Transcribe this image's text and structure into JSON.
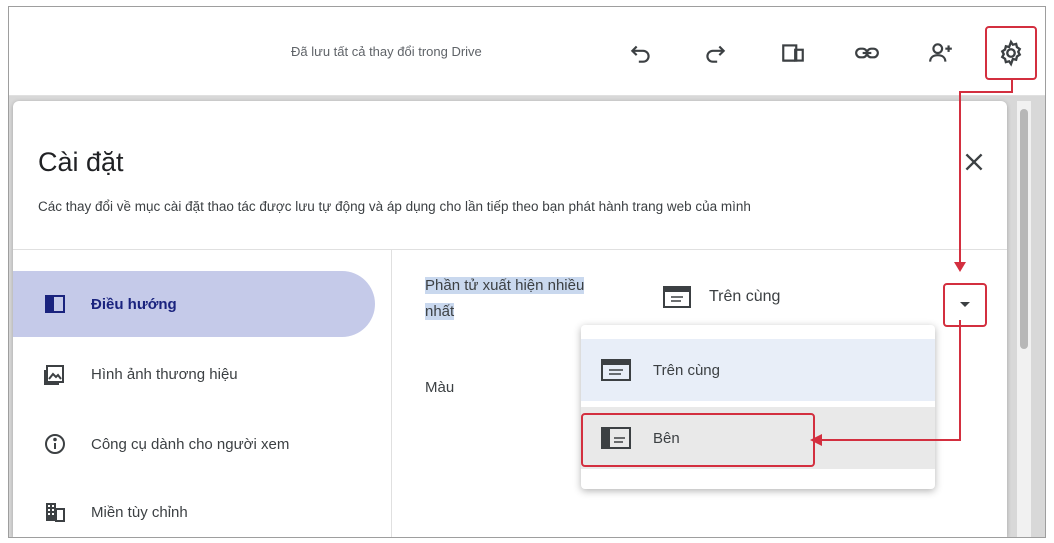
{
  "toolbar": {
    "saved_status": "Đã lưu tất cả thay đổi trong Drive",
    "icons": [
      "undo-icon",
      "redo-icon",
      "preview-icon",
      "link-icon",
      "share-icon",
      "gear-icon"
    ]
  },
  "settings": {
    "title": "Cài đặt",
    "description": "Các thay đổi về mục cài đặt thao tác được lưu tự động và áp dụng cho lần tiếp theo bạn phát hành trang web của mình",
    "nav": [
      {
        "label": "Điều hướng",
        "icon": "navigation-icon",
        "active": true
      },
      {
        "label": "Hình ảnh thương hiệu",
        "icon": "image-icon",
        "active": false
      },
      {
        "label": "Công cụ dành cho người xem",
        "icon": "info-icon",
        "active": false
      },
      {
        "label": "Miền tùy chỉnh",
        "icon": "domain-icon",
        "active": false
      }
    ],
    "mode_label_line1": "Phần tử xuất hiện nhiều",
    "mode_label_line2": "nhất",
    "mode_value": "Trên cùng",
    "color_label": "Màu",
    "options": [
      "Trên cùng",
      "Bên"
    ]
  },
  "colors": {
    "highlight": "#d32f3f",
    "active_nav": "#c5cae9"
  }
}
